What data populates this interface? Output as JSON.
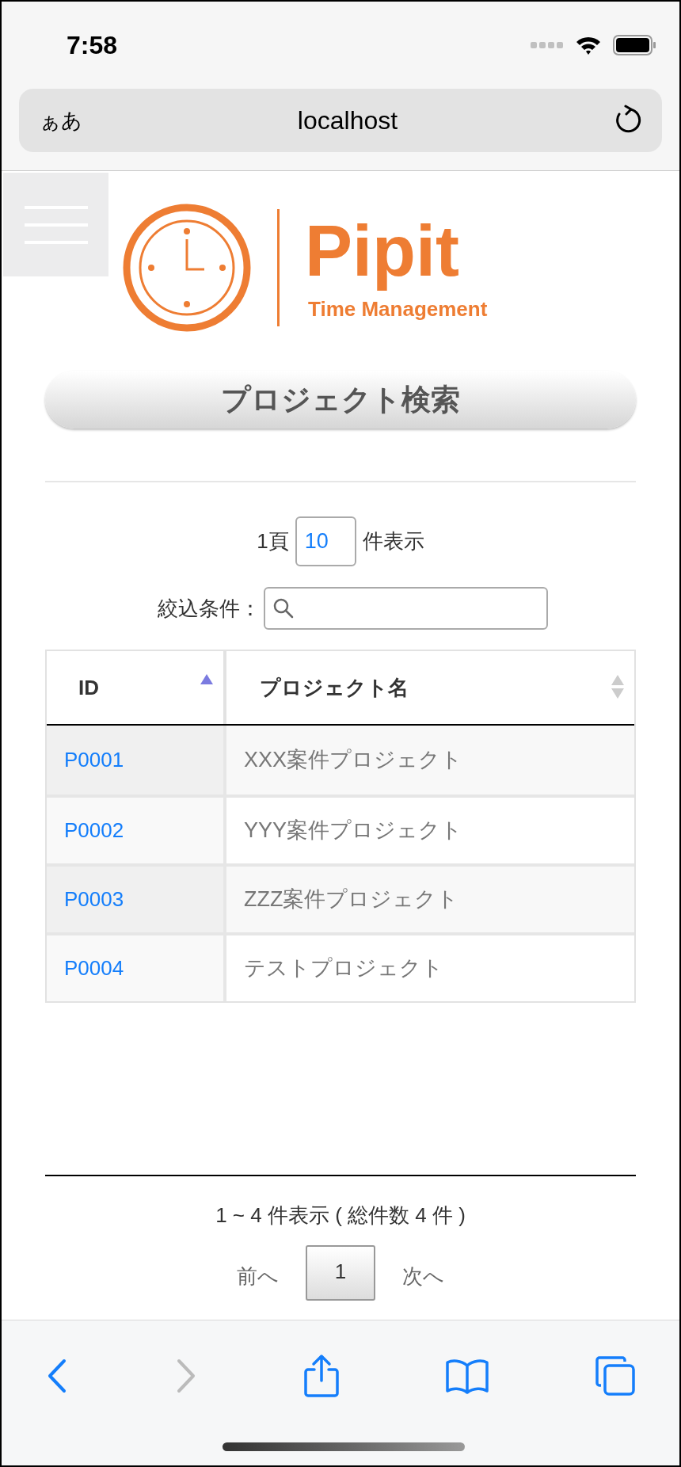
{
  "status_bar": {
    "time": "7:58"
  },
  "address_bar": {
    "text_size_button": "ぁあ",
    "url": "localhost"
  },
  "logo": {
    "name": "Pipit",
    "tagline": "Time Management"
  },
  "title": "プロジェクト検索",
  "page_size": {
    "label_before": "1頁",
    "value": "10",
    "label_after": "件表示"
  },
  "filter": {
    "label": "絞込条件："
  },
  "table": {
    "columns": [
      {
        "label": "ID",
        "sorted": true
      },
      {
        "label": "プロジェクト名",
        "sorted": false
      }
    ],
    "rows": [
      {
        "id": "P0001",
        "name": "XXX案件プロジェクト"
      },
      {
        "id": "P0002",
        "name": "YYY案件プロジェクト"
      },
      {
        "id": "P0003",
        "name": "ZZZ案件プロジェクト"
      },
      {
        "id": "P0004",
        "name": "テストプロジェクト"
      }
    ]
  },
  "summary": "1 ~ 4 件表示 ( 総件数 4 件 )",
  "pagination": {
    "previous": "前へ",
    "pages": [
      {
        "label": "1",
        "selected": true
      }
    ],
    "next": "次へ"
  },
  "toolbar": {
    "back_enabled": true,
    "forward_enabled": false
  }
}
